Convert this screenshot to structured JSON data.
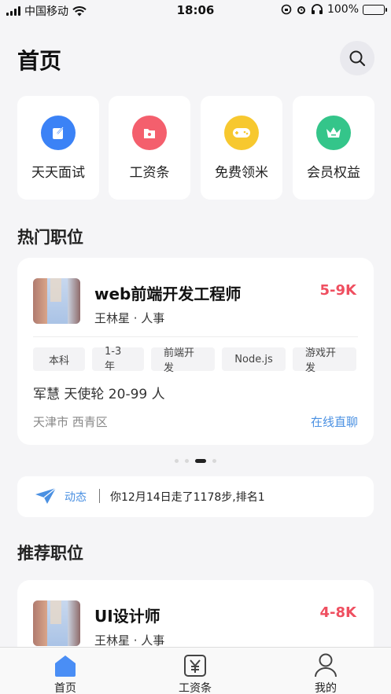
{
  "status_bar": {
    "carrier": "中国移动",
    "time": "18:06",
    "battery": "100%"
  },
  "header": {
    "title": "首页"
  },
  "quick_actions": [
    {
      "label": "天天面试",
      "icon": "interview-icon",
      "color": "#3b82f6"
    },
    {
      "label": "工资条",
      "icon": "payslip-icon",
      "color": "#f45f6d"
    },
    {
      "label": "免费领米",
      "icon": "gamepad-icon",
      "color": "#f7c82f"
    },
    {
      "label": "会员权益",
      "icon": "crown-icon",
      "color": "#34c58a"
    }
  ],
  "hot_jobs": {
    "title": "热门职位",
    "card": {
      "title": "web前端开发工程师",
      "salary": "5-9K",
      "recruiter": "王林星 · 人事",
      "tags": [
        "本科",
        "1-3年",
        "前端开发",
        "Node.js",
        "游戏开发"
      ],
      "company": "军慧 天使轮 20-99 人",
      "location": "天津市 西青区",
      "action": "在线直聊"
    },
    "carousel": {
      "count": 4,
      "active": 3
    }
  },
  "activity": {
    "tag": "动态",
    "message": "你12月14日走了1178步,排名1"
  },
  "recommended": {
    "title": "推荐职位",
    "card": {
      "title": "UI设计师",
      "salary": "4-8K",
      "recruiter": "王林星 · 人事"
    }
  },
  "tabbar": {
    "items": [
      {
        "label": "首页",
        "icon": "home-icon",
        "active": true
      },
      {
        "label": "工资条",
        "icon": "yen-icon",
        "active": false
      },
      {
        "label": "我的",
        "icon": "profile-icon",
        "active": false
      }
    ]
  },
  "colors": {
    "accent": "#4a90e2",
    "salary": "#ef4f60",
    "background": "#f5f5f7"
  }
}
